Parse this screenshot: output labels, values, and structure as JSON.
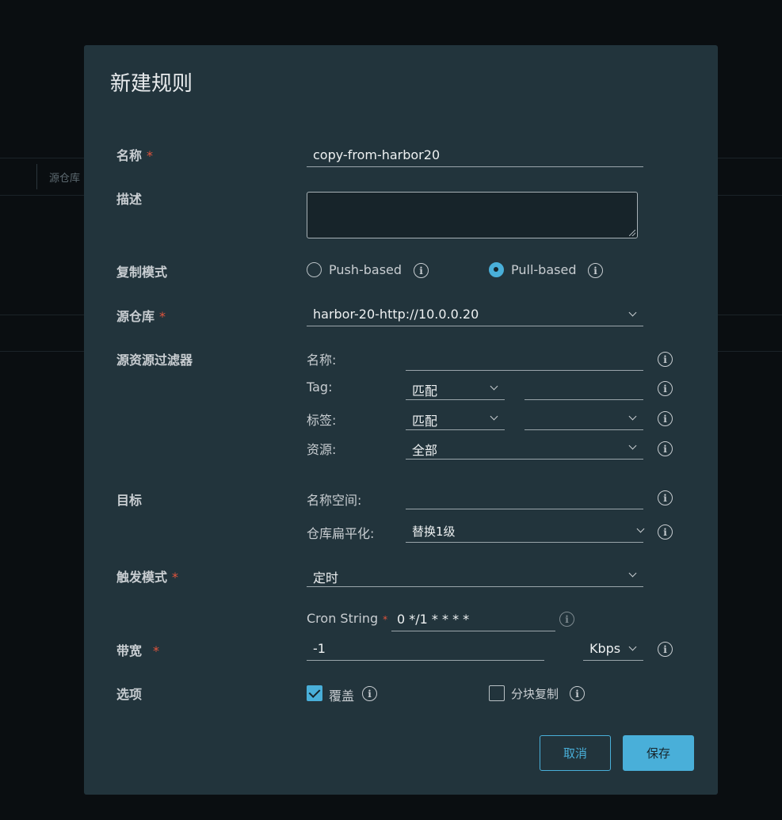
{
  "background": {
    "column_label": "源仓库"
  },
  "dialog": {
    "title": "新建规则",
    "name": {
      "label": "名称",
      "required": "*",
      "value": "copy-from-harbor20"
    },
    "description": {
      "label": "描述",
      "value": ""
    },
    "replication_mode": {
      "label": "复制模式",
      "options": [
        {
          "label": "Push-based",
          "selected": false
        },
        {
          "label": "Pull-based",
          "selected": true
        }
      ]
    },
    "source_registry": {
      "label": "源仓库",
      "required": "*",
      "value": "harbor-20-http://10.0.0.20"
    },
    "source_filter": {
      "label": "源资源过滤器",
      "name": {
        "label": "名称:",
        "value": ""
      },
      "tag": {
        "label": "Tag:",
        "match": "匹配",
        "value": ""
      },
      "labels": {
        "label": "标签:",
        "match": "匹配",
        "value": ""
      },
      "resource": {
        "label": "资源:",
        "value": "全部"
      }
    },
    "destination": {
      "label": "目标",
      "namespace": {
        "label": "名称空间:",
        "value": ""
      },
      "flattening": {
        "label": "仓库扁平化:",
        "value": "替换1级"
      }
    },
    "trigger_mode": {
      "label": "触发模式",
      "required": "*",
      "value": "定时",
      "cron_label": "Cron String",
      "cron_required": "*",
      "cron_value": "0 */1 * * * *"
    },
    "bandwidth": {
      "label": "带宽",
      "required": "*",
      "value": "-1",
      "unit": "Kbps"
    },
    "options": {
      "label": "选项",
      "override": {
        "label": "覆盖",
        "checked": true
      },
      "chunked": {
        "label": "分块复制",
        "checked": false
      }
    },
    "buttons": {
      "cancel": "取消",
      "save": "保存"
    }
  },
  "colors": {
    "accent": "#49afd9",
    "modal_bg": "#22343c",
    "required": "#e2543c"
  },
  "icons": {
    "info": "info-circle-icon",
    "dropdown": "chevron-down-icon"
  }
}
